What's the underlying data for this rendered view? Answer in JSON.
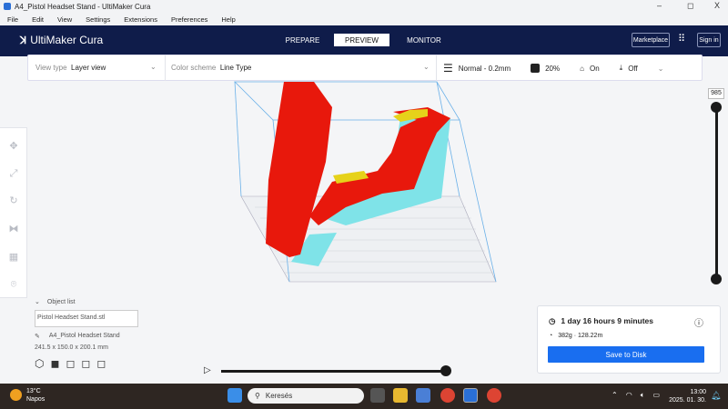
{
  "window": {
    "title": "A4_Pistol Headset Stand - UltiMaker Cura",
    "minimize": "–",
    "maximize": "◻",
    "close": "X"
  },
  "menu": [
    "File",
    "Edit",
    "View",
    "Settings",
    "Extensions",
    "Preferences",
    "Help"
  ],
  "header": {
    "logo": "UltiMaker Cura",
    "tabs": [
      "PREPARE",
      "PREVIEW",
      "MONITOR"
    ],
    "active_tab": "PREVIEW",
    "marketplace": "Marketplace",
    "signin": "Sign in"
  },
  "toolbar": {
    "view_type_label": "View type",
    "view_type": "Layer view",
    "color_scheme_label": "Color scheme",
    "color_scheme": "Line Type",
    "profile": "Normal - 0.2mm",
    "infill": "20%",
    "support": "On",
    "adhesion": "Off"
  },
  "layer_slider": {
    "current_layer": "985"
  },
  "object_panel": {
    "header": "Object list",
    "object_file": "Pistol Headset Stand.stl",
    "job_name": "A4_Pistol Headset Stand",
    "dimensions": "241.5 x 150.0 x 200.1 mm"
  },
  "estimate": {
    "time": "1 day 16 hours 9 minutes",
    "material": "382g · 128.22m",
    "save": "Save to Disk"
  },
  "playback": {
    "progress": 1.0
  },
  "taskbar": {
    "temp": "13°C",
    "weather": "Napos",
    "search": "Keresés",
    "time": "13:00",
    "date": "2025. 01. 30."
  },
  "colors": {
    "header": "#0f1c4a",
    "accent": "#196ef0",
    "model_wall": "#e8180c",
    "support": "#6fe0e6",
    "skin": "#e6d21a"
  }
}
